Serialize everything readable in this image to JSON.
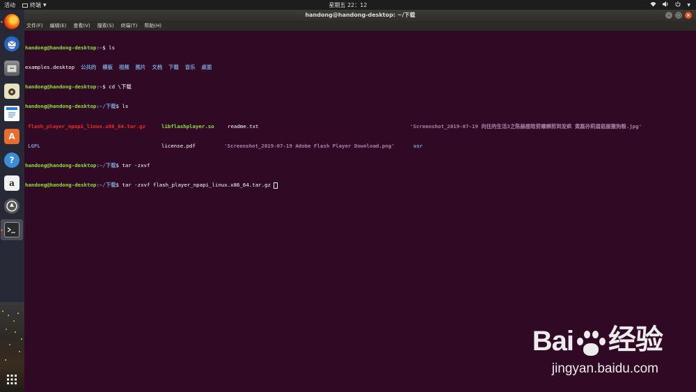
{
  "topbar": {
    "activities": "活动",
    "app_name": "终端",
    "clock": "星期五 22：12",
    "icons": [
      "network-icon",
      "volume-icon",
      "power-icon"
    ]
  },
  "dock": {
    "apps": [
      "firefox-icon",
      "thunderbird-icon",
      "files-icon",
      "rhythmbox-icon",
      "libreoffice-writer-icon",
      "software-center-icon",
      "help-icon",
      "amazon-icon",
      "software-updater-icon",
      "terminal-icon",
      "show-applications-icon"
    ],
    "amazon_glyph": "a",
    "help_glyph": "?",
    "store_glyph": "A"
  },
  "window": {
    "title": "handong@handong-desktop: ~/下载",
    "menu": [
      "文件(F)",
      "编辑(E)",
      "查看(V)",
      "搜索(S)",
      "终端(T)",
      "帮助(H)"
    ]
  },
  "terminal": {
    "prompt_user": "handong@handong-desktop",
    "line1_path": ":~",
    "line1_cmd": "$ ls",
    "line2_items": [
      "examples.desktop",
      "公共的",
      "模板",
      "视频",
      "图片",
      "文档",
      "下载",
      "音乐",
      "桌面"
    ],
    "line3_path": ":~",
    "line3_cmd": "$ cd \\下载",
    "line4_path": ":~/下载",
    "line4_cmd": "$ ls",
    "ls_archive": "flash_player_npapi_linux.x86_64.tar.gz",
    "ls_lib": "libflashplayer.so",
    "ls_readme": "readme.txt",
    "ls_shot1": "'Screenshot_2019-07-19 向往的生活3之陈赫鹿晗剪螺蛳剪到发疯 黄磊孙莉眉菇屋撒狗粮.jpg'",
    "ls_lgpl": "LGPL",
    "ls_license": "license.pdf",
    "ls_shot2": "'Screenshot_2019-07-19 Adobe Flash Player Download.png'",
    "ls_usr": "usr",
    "line7_path": ":~/下载",
    "line7_cmd": "$ tar -zxvf",
    "line8_path": ":~/下载",
    "line8_cmd": "$ tar -zxvf flash_player_npapi_linux.x86_64.tar.gz "
  },
  "watermark": {
    "logo_left": "Bai",
    "logo_right": "经验",
    "url": "jingyan.baidu.com"
  },
  "colors": {
    "terminal_bg": "#300a24",
    "prompt_green": "#8ae234",
    "path_blue": "#729fcf",
    "archive_red": "#ef2929",
    "quoted_purple": "#ad7fa8",
    "ubuntu_orange": "#e95420"
  }
}
